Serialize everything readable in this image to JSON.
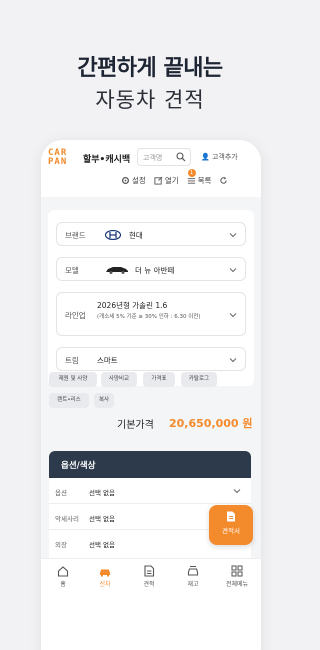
{
  "promo": {
    "title": "간편하게 끝내는",
    "subtitle": "자동차 견적"
  },
  "header": {
    "logo_top": "CAR",
    "logo_bottom": "PAN",
    "brand_tab": "할부•캐시백",
    "search_placeholder": "고객명",
    "customer_add": "고객추가",
    "toolbar": [
      {
        "label": "설정",
        "icon": "gear-icon"
      },
      {
        "label": "열기",
        "icon": "open-icon"
      },
      {
        "label": "목록",
        "icon": "list-icon",
        "badge": "1"
      },
      {
        "label": "",
        "icon": "refresh-icon"
      }
    ]
  },
  "fields": {
    "brand": {
      "label": "브랜드",
      "value": "현대"
    },
    "model": {
      "label": "모델",
      "value": "더 뉴 아반떼"
    },
    "lineup": {
      "label": "라인업",
      "value": "2026년형 가솔린 1.6",
      "note": "(개소세 5% 기준 ≥ 30% 인하 : 6.30 이전)"
    },
    "trim": {
      "label": "트림",
      "value": "스마트"
    }
  },
  "tags": [
    "제원 및 사양",
    "사양비교",
    "가격표",
    "카탈로그",
    "렌트•리스",
    "복사"
  ],
  "price": {
    "label": "기본가격",
    "value": "20,650,000 원"
  },
  "options": {
    "title": "옵션/색상",
    "rows": [
      {
        "key": "옵션",
        "value": "선택 없음"
      },
      {
        "key": "악세사리",
        "value": "선택 없음"
      },
      {
        "key": "외장",
        "value": "선택 없음"
      }
    ]
  },
  "fab": {
    "label": "견적서"
  },
  "tabbar": [
    {
      "label": "홈",
      "icon": "home-icon"
    },
    {
      "label": "신차",
      "icon": "car-icon",
      "active": true
    },
    {
      "label": "견적",
      "icon": "document-icon"
    },
    {
      "label": "재고",
      "icon": "stock-icon"
    },
    {
      "label": "전체메뉴",
      "icon": "menu-icon"
    }
  ],
  "colors": {
    "accent": "#f38a2b",
    "header_dark": "#2c3a4b"
  }
}
